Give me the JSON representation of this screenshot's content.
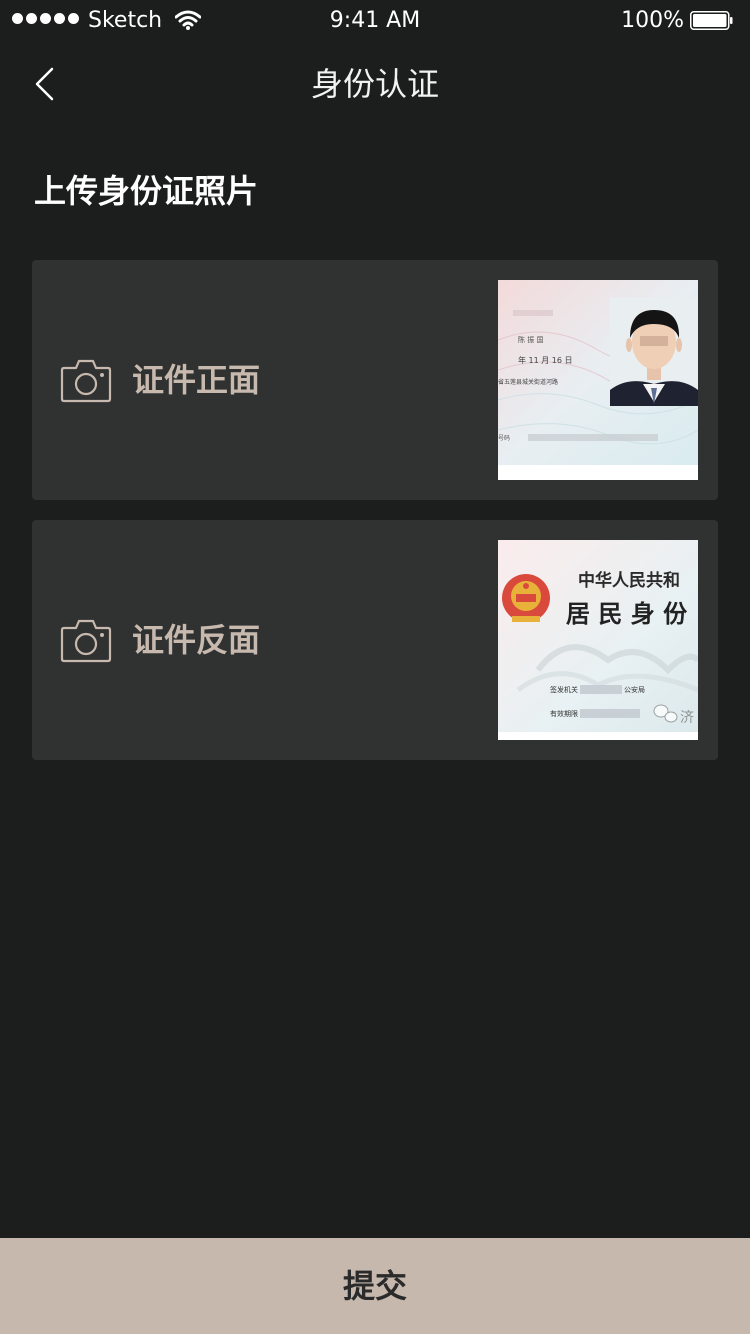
{
  "status_bar": {
    "carrier": "Sketch",
    "time": "9:41 AM",
    "battery": "100%"
  },
  "nav": {
    "title": "身份认证",
    "back_icon": "chevron-left-icon"
  },
  "section": {
    "title": "上传身份证照片"
  },
  "cards": [
    {
      "label": "证件正面",
      "icon": "camera-icon",
      "thumbnail": {
        "name_line": "陈 振 国",
        "date_line": "年  11 月 16 日",
        "address_line": "省五莲县城关街道河路",
        "id_line": "号码"
      }
    },
    {
      "label": "证件反面",
      "icon": "camera-icon",
      "thumbnail": {
        "country_line": "中华人民共和",
        "doc_line": "居 民 身 份",
        "authority_label": "签发机关",
        "authority_value": "公安局",
        "validity_label": "有效期限"
      }
    }
  ],
  "submit": {
    "label": "提交"
  },
  "colors": {
    "background": "#1c1d1d",
    "card": "#303232",
    "accent": "#c7b8ad",
    "label": "#c8b9ae"
  }
}
